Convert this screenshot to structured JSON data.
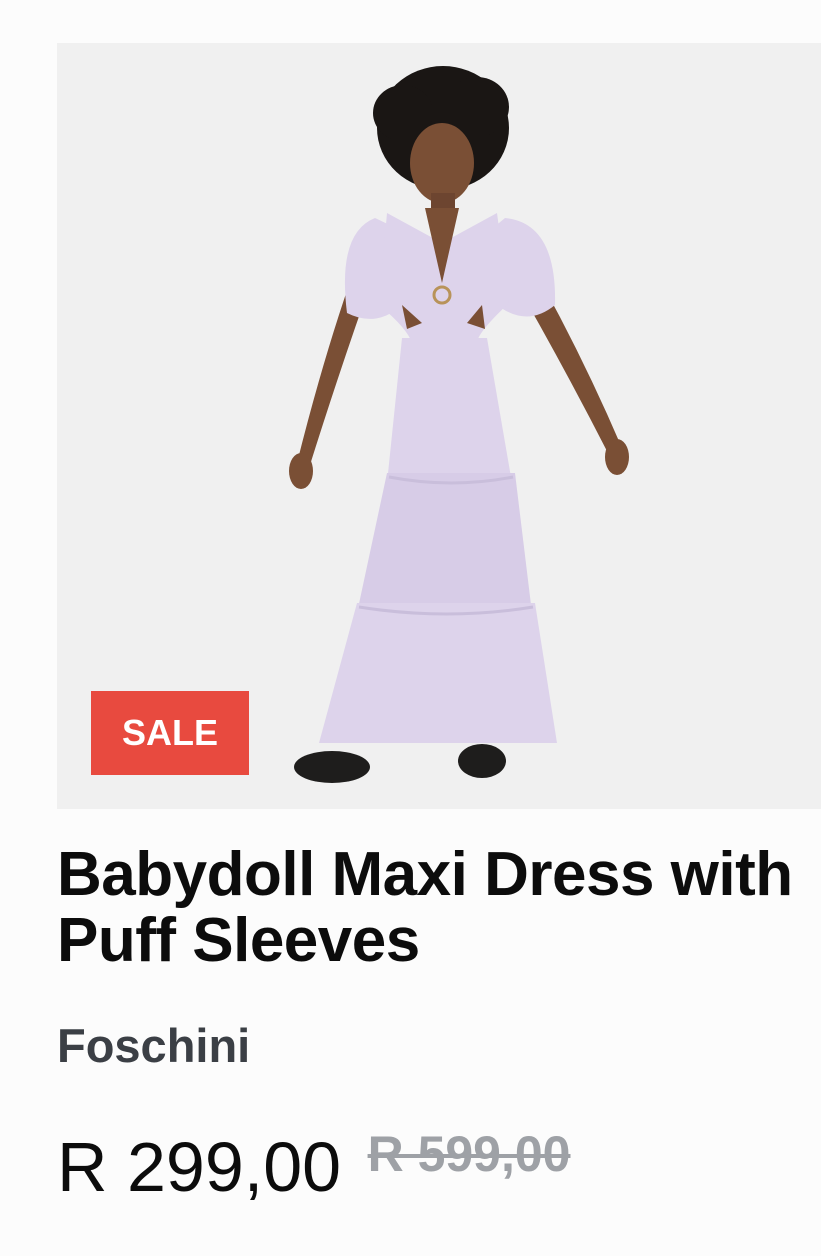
{
  "product": {
    "badge": "SALE",
    "title": "Babydoll Maxi Dress with Puff Sleeves",
    "brand": "Foschini",
    "price_current": "R 299,00",
    "price_original": "R 599,00",
    "image_description": "product photo",
    "dress_color": "#ddd3eb",
    "badge_color": "#e84a3f"
  }
}
